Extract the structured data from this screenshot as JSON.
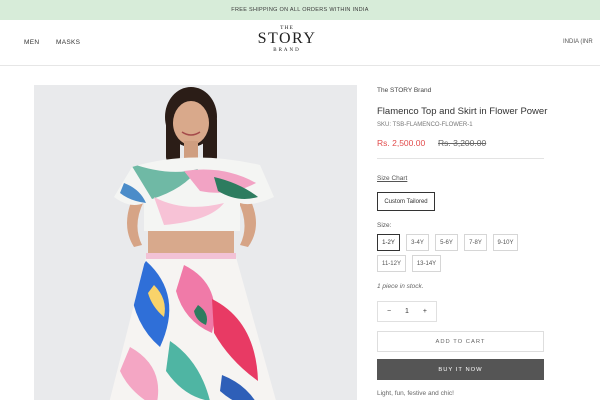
{
  "announcement": "FREE SHIPPING ON ALL ORDERS WITHIN INDIA",
  "nav": {
    "men": "MEN",
    "masks": "MASKS",
    "country": "INDIA (INR"
  },
  "logo": {
    "top": "THE",
    "main": "STORY",
    "bottom": "BRAND"
  },
  "product": {
    "vendor": "The STORY Brand",
    "title": "Flamenco Top and Skirt in Flower Power",
    "sku": "SKU: TSB-FLAMENCO-FLOWER-1",
    "price": "Rs. 2,500.00",
    "compare_price": "Rs. 3,200.00",
    "size_chart": "Size Chart",
    "style_option": "Custom Tailored",
    "size_label": "Size:",
    "sizes": [
      "1-2Y",
      "3-4Y",
      "5-6Y",
      "7-8Y",
      "9-10Y",
      "11-12Y",
      "13-14Y"
    ],
    "selected_size": "1-2Y",
    "stock": "1 piece in stock.",
    "quantity": {
      "minus": "−",
      "value": "1",
      "plus": "+"
    },
    "add_to_cart": "ADD TO CART",
    "buy_now": "BUY IT NOW",
    "description": "Light, fun, festive and chic!"
  },
  "colors": {
    "announcement_bg": "#d7ecd9",
    "price": "#e24b4b",
    "buy_button": "#555555"
  }
}
